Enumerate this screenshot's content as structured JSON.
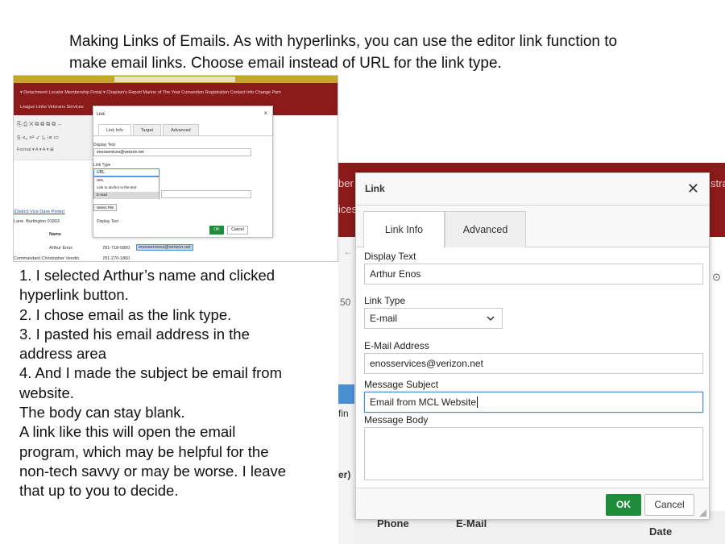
{
  "slide": {
    "title_line1": "Making Links of Emails. As with hyperlinks, you can use the editor link function to",
    "title_line2": "make email links.  Choose email instead of URL for the link type."
  },
  "small_screenshot": {
    "nav_row1": "▾   Detachment Locator   Membership Portal ▾   Chaplain's Report   Marine of The Year   Convention Registration   Contact Info Change   Pam",
    "nav_row2": "League Links   Veterans Services",
    "toolbar_row1": "⎘  ⎙  ✕  ⧉  ⧉  ⧉  ⧉  ←",
    "toolbar_row2": "S  ×ₓ  ×²  ✓  Iₓ  ⁝≡  ≔",
    "toolbar_row3": "Format   ▾   A ▾   A ▾   ⊞",
    "dialog_title": "Link",
    "tabs": [
      "Link Info",
      "Target",
      "Advanced"
    ],
    "display_text_label": "Display Text",
    "display_text_value": "enosservices@verizon.net",
    "link_type_label": "Link Type",
    "link_type_value": "URL",
    "dropdown_options": [
      "URL",
      "Link to anchor in the text",
      "E-mail"
    ],
    "select_file": "Select File",
    "ok": "OK",
    "cancel": "Cancel",
    "page_text1": "(District Vice Dave Porter)",
    "page_text2": "Lane. Burlington 01803",
    "page_text3": "Name",
    "row1_name": "Arthur Enos",
    "row1_phone": "781-718-0800",
    "row1_email": "enosservices@verizon.net",
    "row2_name": "Commandant Christopher Vendio",
    "row2_phone": "781-270-1860"
  },
  "steps": [
    "1. I selected Arthur’s name and clicked",
    "hyperlink button.",
    "2. I chose email as the link type.",
    "3. I pasted his email address in the",
    "address area",
    "4. And I made the subject be email from",
    "website.",
    "The body can stay blank.",
    "A link like this will open the email",
    "program, which may be helpful for the",
    "non-tech savvy or may be worse. I leave",
    "that up to you to decide."
  ],
  "background": {
    "nav_fragment_left1": "ber",
    "nav_fragment_left2": "ices",
    "nav_fragment_right": "stra",
    "left_fragment_fin": "fin",
    "left_fragment_er": "er)",
    "col_phone": "Phone",
    "col_email": "E-Mail",
    "col_date": "Date"
  },
  "dialog": {
    "title": "Link",
    "tabs": {
      "link_info": "Link Info",
      "advanced": "Advanced"
    },
    "display_text_label": "Display Text",
    "display_text_value": "Arthur Enos",
    "link_type_label": "Link Type",
    "link_type_value": "E-mail",
    "email_label": "E-Mail Address",
    "email_value": "enosservices@verizon.net",
    "subject_label": "Message Subject",
    "subject_value": "Email from MCL Website",
    "body_label": "Message Body",
    "ok": "OK",
    "cancel": "Cancel"
  },
  "colors": {
    "nav": "#8b1a1a",
    "ok_button": "#1e8c3a",
    "focus": "#4a8fd6"
  }
}
